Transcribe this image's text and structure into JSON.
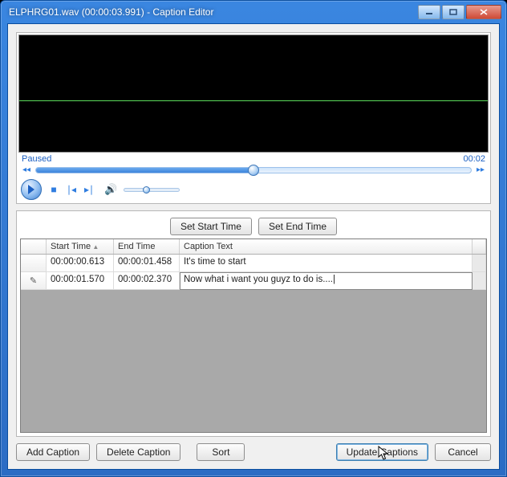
{
  "window": {
    "title": "ELPHRG01.wav (00:00:03.991) - Caption Editor"
  },
  "player": {
    "status": "Paused",
    "elapsed": "00:02",
    "seek_percent": 50,
    "volume_percent": 34
  },
  "time_buttons": {
    "set_start": "Set Start Time",
    "set_end": "Set End Time"
  },
  "grid": {
    "headers": {
      "start": "Start Time",
      "end": "End Time",
      "text": "Caption Text"
    },
    "rows": [
      {
        "start": "00:00:00.613",
        "end": "00:00:01.458",
        "text": "It's time to start",
        "editing": false
      },
      {
        "start": "00:00:01.570",
        "end": "00:00:02.370",
        "text": "Now what i want you guyz to do is....|",
        "editing": true
      }
    ]
  },
  "footer": {
    "add": "Add Caption",
    "delete": "Delete Caption",
    "sort": "Sort",
    "update": "Update Captions",
    "cancel": "Cancel"
  }
}
